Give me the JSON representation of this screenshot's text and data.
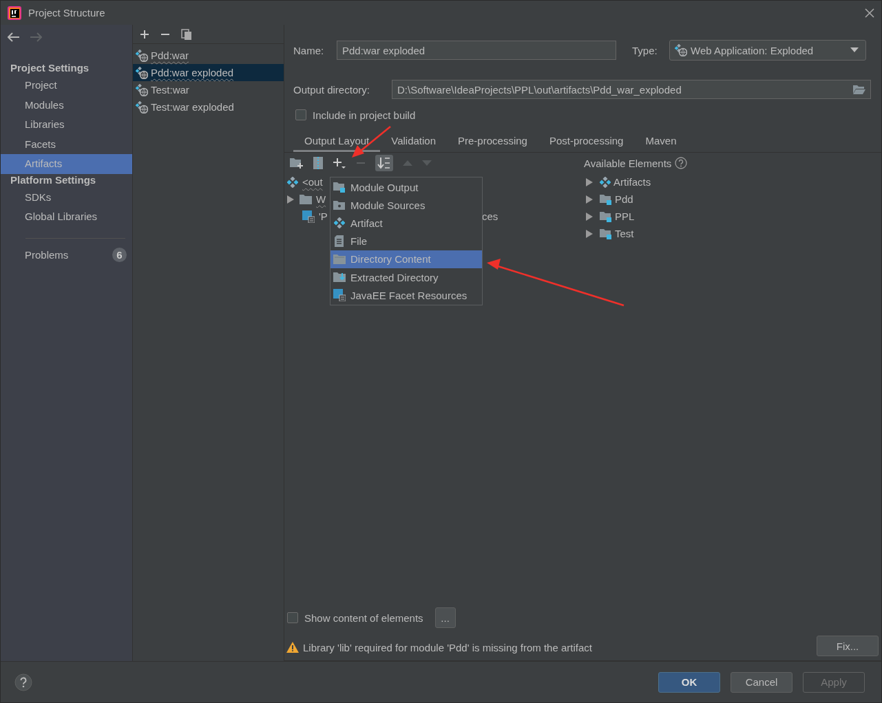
{
  "window": {
    "title": "Project Structure"
  },
  "sidebar": {
    "sections": [
      {
        "title": "Project Settings",
        "items": [
          {
            "label": "Project",
            "selected": false
          },
          {
            "label": "Modules",
            "selected": false
          },
          {
            "label": "Libraries",
            "selected": false
          },
          {
            "label": "Facets",
            "selected": false
          },
          {
            "label": "Artifacts",
            "selected": true
          }
        ]
      },
      {
        "title": "Platform Settings",
        "items": [
          {
            "label": "SDKs",
            "selected": false
          },
          {
            "label": "Global Libraries",
            "selected": false
          }
        ]
      }
    ],
    "problems": {
      "label": "Problems",
      "count": "6"
    }
  },
  "artifacts": [
    {
      "label": "Pdd:war",
      "selected": false
    },
    {
      "label": "Pdd:war exploded",
      "selected": true
    },
    {
      "label": "Test:war",
      "selected": false
    },
    {
      "label": "Test:war exploded",
      "selected": false
    }
  ],
  "name_field": {
    "label": "Name:",
    "value": "Pdd:war exploded"
  },
  "type_field": {
    "label": "Type:",
    "value": "Web Application: Exploded"
  },
  "output_directory": {
    "label": "Output directory:",
    "value": "D:\\Software\\IdeaProjects\\PPL\\out\\artifacts\\Pdd_war_exploded"
  },
  "include_in_build": {
    "label": "Include in project build",
    "checked": false
  },
  "tabs": [
    {
      "label": "Output Layout",
      "selected": true
    },
    {
      "label": "Validation",
      "selected": false
    },
    {
      "label": "Pre-processing",
      "selected": false
    },
    {
      "label": "Post-processing",
      "selected": false
    },
    {
      "label": "Maven",
      "selected": false
    }
  ],
  "layout_tree": [
    {
      "text": "<out",
      "kind": "artifact",
      "expandable": false
    },
    {
      "text": "W",
      "kind": "folder",
      "expandable": true
    },
    {
      "text": "'P",
      "kind": "facet",
      "expandable": false,
      "tail": "ces"
    }
  ],
  "popup": {
    "items": [
      {
        "label": "Module Output",
        "kind": "module-output",
        "selected": false
      },
      {
        "label": "Module Sources",
        "kind": "module-sources",
        "selected": false
      },
      {
        "label": "Artifact",
        "kind": "artifact",
        "selected": false
      },
      {
        "label": "File",
        "kind": "file",
        "selected": false
      },
      {
        "label": "Directory Content",
        "kind": "directory",
        "selected": true
      },
      {
        "label": "Extracted Directory",
        "kind": "extracted",
        "selected": false
      },
      {
        "label": "JavaEE Facet Resources",
        "kind": "facet",
        "selected": false
      }
    ]
  },
  "available": {
    "title": "Available Elements",
    "items": [
      {
        "label": "Artifacts",
        "kind": "artifact"
      },
      {
        "label": "Pdd",
        "kind": "module"
      },
      {
        "label": "PPL",
        "kind": "module"
      },
      {
        "label": "Test",
        "kind": "module"
      }
    ]
  },
  "show_content": {
    "label": "Show content of elements",
    "checked": false,
    "button": "..."
  },
  "warning": {
    "text": "Library 'lib' required for module 'Pdd' is missing from the artifact",
    "button": "Fix..."
  },
  "buttons": [
    {
      "label": "OK",
      "kind": "primary"
    },
    {
      "label": "Cancel",
      "kind": "normal"
    },
    {
      "label": "Apply",
      "kind": "disabled"
    }
  ]
}
